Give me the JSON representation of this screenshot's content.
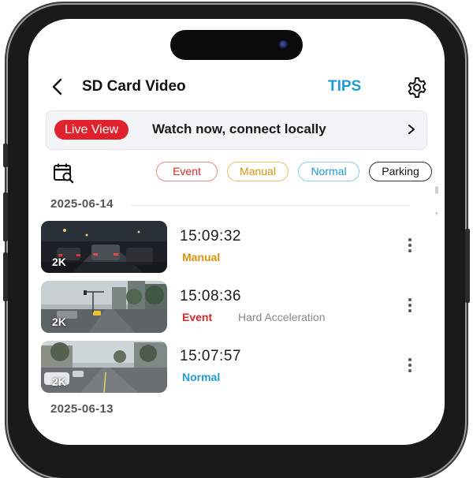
{
  "header": {
    "title": "SD Card Video",
    "tips_label": "TIPS"
  },
  "live_banner": {
    "badge": "Live View",
    "text": "Watch now, connect locally",
    "chevron": ">"
  },
  "filters": [
    {
      "label": "Event",
      "color": "#d42a2a"
    },
    {
      "label": "Manual",
      "color": "#d8930c"
    },
    {
      "label": "Normal",
      "color": "#1e9ad6"
    },
    {
      "label": "Parking",
      "color": "#111111"
    }
  ],
  "groups": [
    {
      "date": "2025-06-14",
      "videos": [
        {
          "time": "15:09:32",
          "tag": "Manual",
          "tag_color": "#d8930c",
          "detail": "",
          "resolution": "2K"
        },
        {
          "time": "15:08:36",
          "tag": "Event",
          "tag_color": "#d42a2a",
          "detail": "Hard Acceleration",
          "resolution": "2K"
        },
        {
          "time": "15:07:57",
          "tag": "Normal",
          "tag_color": "#1e9ad6",
          "detail": "",
          "resolution": "2K"
        }
      ]
    },
    {
      "date": "2025-06-13",
      "videos": []
    }
  ],
  "icons": {
    "back": "back-arrow-icon",
    "settings": "gear-icon",
    "calendar": "calendar-search-icon",
    "more": "more-vertical-icon"
  }
}
